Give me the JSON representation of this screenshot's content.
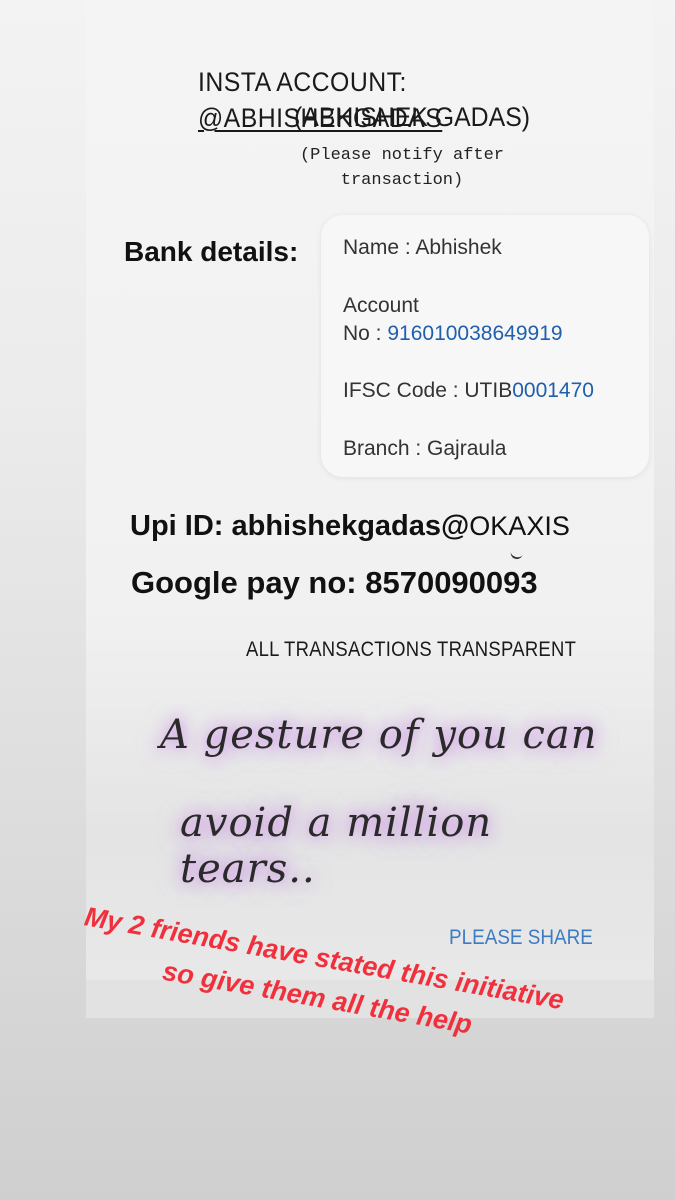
{
  "header": {
    "insta_prefix": "INSTA ACCOUNT: ",
    "insta_handle": "@ABHISHEKGADAS",
    "insta_name": "(ABHISHEK GADAS)",
    "notify_line1": "(Please notify after",
    "notify_line2": "transaction)"
  },
  "bank": {
    "label": "Bank details:",
    "name_line": "Name : Abhishek",
    "account_label": "Account",
    "account_no_prefix": "No : ",
    "account_no": "916010038649919",
    "ifsc_prefix": "IFSC Code : UTIB",
    "ifsc_number": "0001470",
    "branch_line": "Branch : Gajraula"
  },
  "payment": {
    "upi_label": "Upi ID: abhishekgadas@",
    "upi_suffix": "OKAXIS",
    "gpay_line": "Google pay no: 8570090093"
  },
  "footer": {
    "transparent": "ALL TRANSACTIONS TRANSPARENT",
    "quote_line1": "A gesture of you can",
    "quote_line2": "avoid a million tears..",
    "share": "PLEASE SHARE"
  },
  "overlay": {
    "line1": "My 2 friends have stated this initiative",
    "line2": "so give them all the help"
  },
  "colors": {
    "accent_blue": "#1f5fae",
    "overlay_red": "#f0303c",
    "share_blue": "#3d7bc4"
  }
}
